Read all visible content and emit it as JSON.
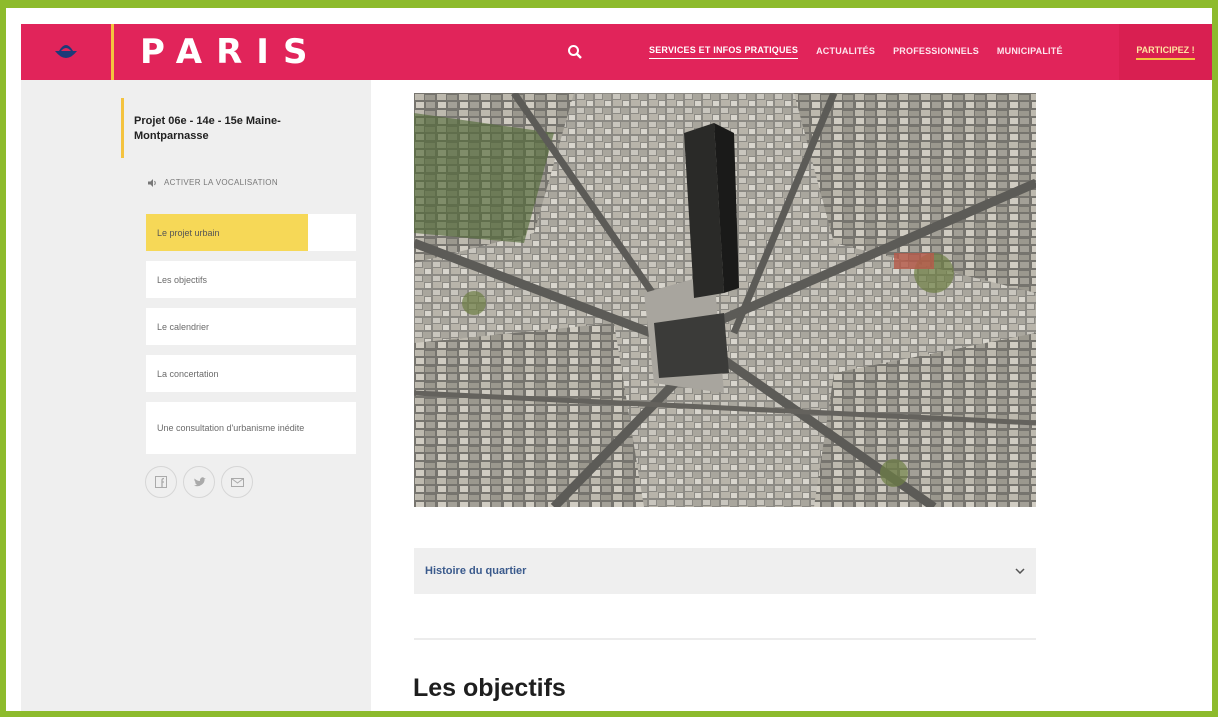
{
  "header": {
    "brand": "PARIS",
    "nav": [
      "SERVICES ET INFOS PRATIQUES",
      "ACTUALITÉS",
      "PROFESSIONNELS",
      "MUNICIPALITÉ"
    ],
    "cta": "PARTICIPEZ !",
    "colors": {
      "bar": "#e1245a",
      "accent": "#f4c33f"
    }
  },
  "sidebar": {
    "project_title": "Projet 06e - 14e - 15e Maine-Montparnasse",
    "vocalisation": "ACTIVER LA VOCALISATION",
    "menu": [
      "Le projet urbain",
      "Les objectifs",
      "Le calendrier",
      "La concertation",
      "Une consultation d'urbanisme inédite"
    ],
    "social_icons": [
      "facebook-icon",
      "twitter-icon",
      "mail-icon"
    ]
  },
  "main": {
    "accordion_label": "Histoire du quartier",
    "section_title": "Les objectifs"
  }
}
